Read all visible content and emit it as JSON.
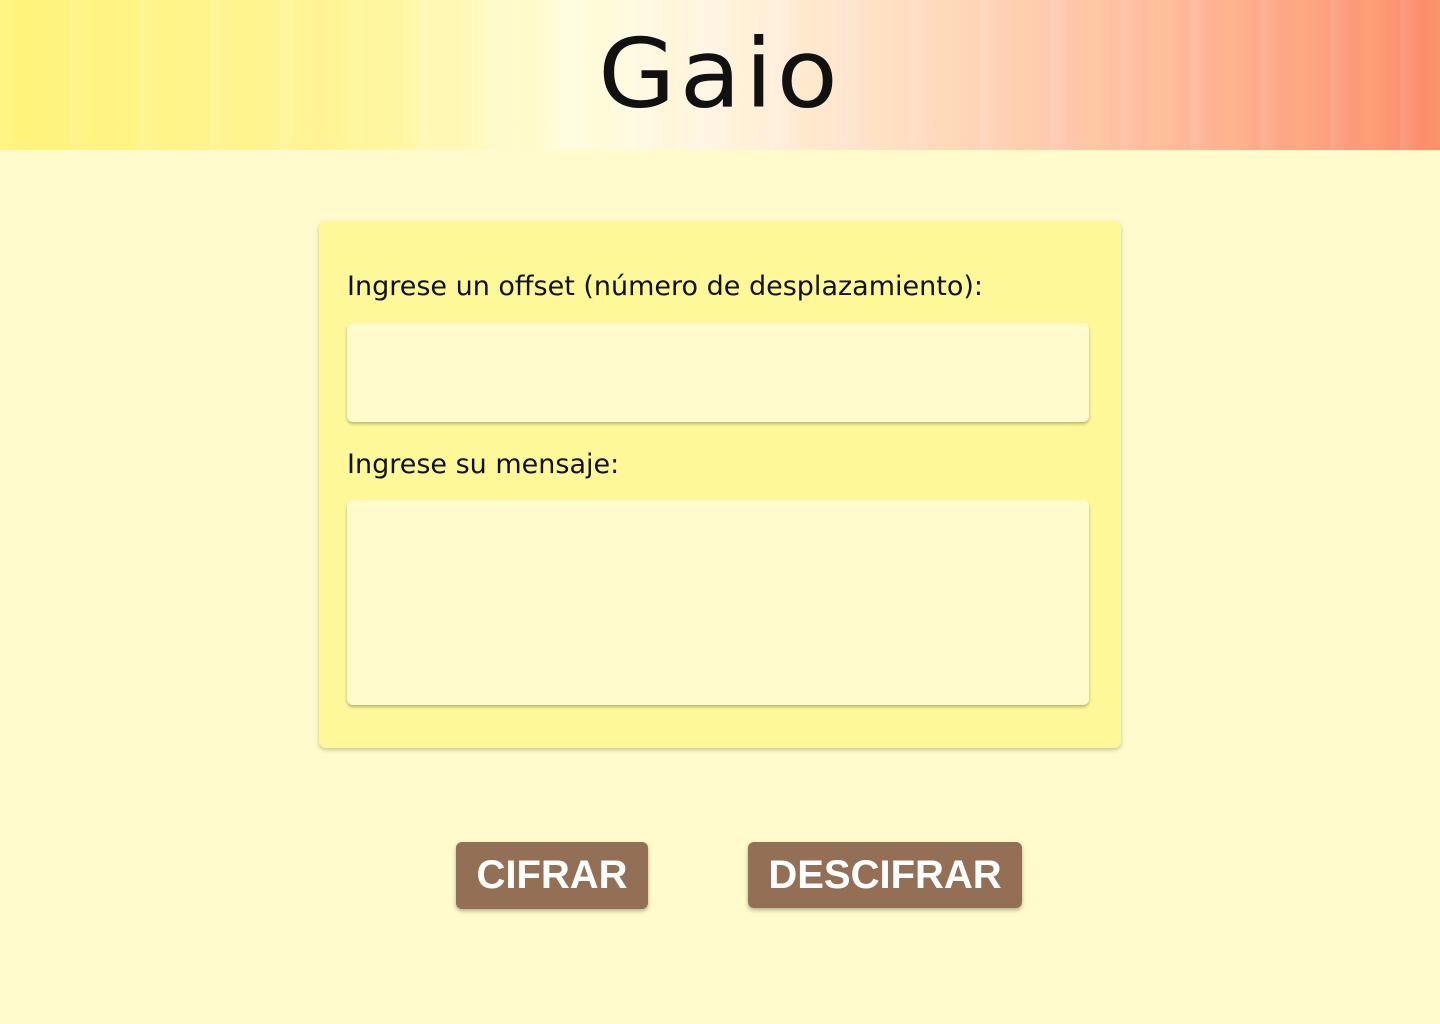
{
  "header": {
    "title": "Gaio"
  },
  "form": {
    "offset_label": "Ingrese un offset (número de desplazamiento):",
    "offset_value": "",
    "message_label": "Ingrese su mensaje:",
    "message_value": ""
  },
  "actions": {
    "encrypt_label": "CIFRAR",
    "decrypt_label": "DESCIFRAR"
  },
  "colors": {
    "page_background": "#fffbcc",
    "card_background": "#fff899",
    "field_background": "#fffbcc",
    "button_background": "#936f56",
    "button_text": "#ffffff"
  }
}
